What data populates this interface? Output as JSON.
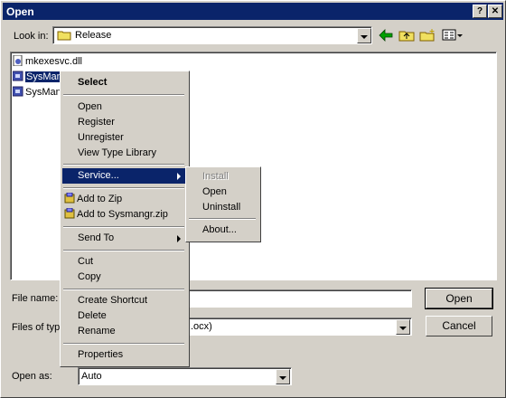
{
  "window": {
    "title": "Open",
    "help_glyph": "?",
    "close_glyph": "✕"
  },
  "lookin": {
    "label": "Look in:",
    "value": "Release"
  },
  "files": [
    {
      "name": "mkexesvc.dll"
    },
    {
      "name": "SysMan"
    },
    {
      "name": "SysMan"
    }
  ],
  "fields": {
    "filename_label": "File name:",
    "filename_value": "",
    "filetype_label": "Files of type",
    "filetype_value": ".ocx)",
    "openas_label": "Open as:",
    "openas_value": "Auto"
  },
  "buttons": {
    "open": "Open",
    "cancel": "Cancel"
  },
  "context_menu": {
    "select": "Select",
    "open": "Open",
    "register": "Register",
    "unregister": "Unregister",
    "view_type_library": "View Type Library",
    "service": "Service...",
    "add_to_zip": "Add to Zip",
    "add_to_named_zip": "Add to Sysmangr.zip",
    "send_to": "Send To",
    "cut": "Cut",
    "copy": "Copy",
    "create_shortcut": "Create Shortcut",
    "delete": "Delete",
    "rename": "Rename",
    "properties": "Properties"
  },
  "submenu": {
    "install": "Install",
    "open": "Open",
    "uninstall": "Uninstall",
    "about": "About..."
  },
  "colors": {
    "titlebar": "#0a246a",
    "face": "#d4d0c8",
    "highlight": "#0a246a"
  }
}
